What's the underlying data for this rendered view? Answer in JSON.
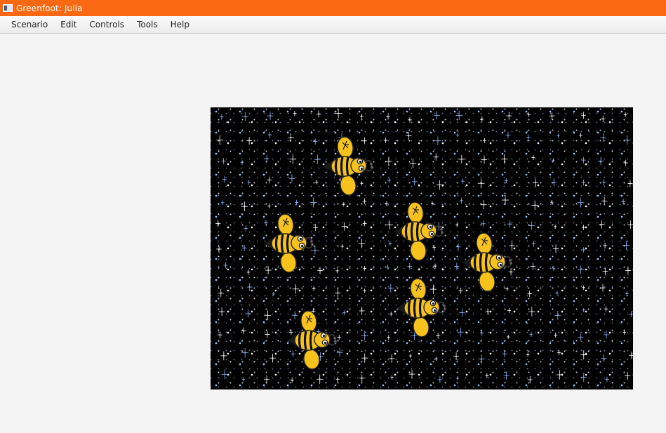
{
  "window": {
    "title": "Greenfoot: Julia",
    "icon": "greenfoot-app-icon"
  },
  "menu": {
    "items": [
      "Scenario",
      "Edit",
      "Controls",
      "Tools",
      "Help"
    ]
  },
  "world": {
    "background": "starfield",
    "actors": [
      {
        "type": "bee",
        "icon": "bee-icon"
      },
      {
        "type": "bee",
        "icon": "bee-icon"
      },
      {
        "type": "bee",
        "icon": "bee-icon"
      },
      {
        "type": "bee",
        "icon": "bee-icon"
      },
      {
        "type": "bee",
        "icon": "bee-icon"
      },
      {
        "type": "bee",
        "icon": "bee-icon"
      }
    ]
  },
  "colors": {
    "titlebar": "#fb6812",
    "bee_body": "#f7c21c",
    "bee_stripe": "#111111",
    "world_bg": "#000000"
  }
}
